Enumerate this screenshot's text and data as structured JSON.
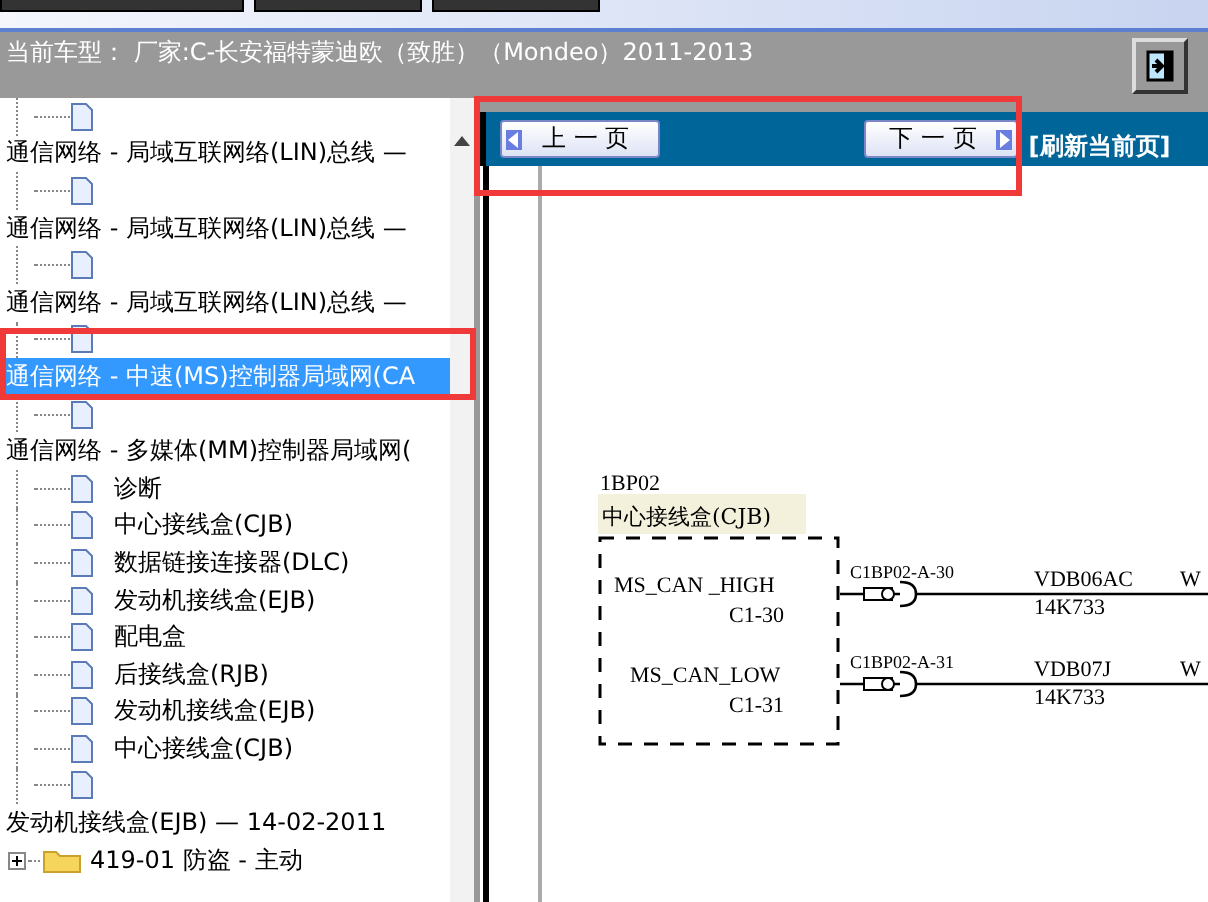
{
  "header": {
    "vehicle_label": "当前车型：  厂家:C-长安福特蒙迪欧（致胜）（Mondeo）2011-2013"
  },
  "tree": [
    {
      "children": [
        {
          "kind": "doc"
        }
      ]
    },
    {
      "kind": "group",
      "label": "通信网络 - 局域互联网络(LIN)总线 —",
      "selected": false,
      "children": [
        {
          "kind": "doc"
        }
      ]
    },
    {
      "kind": "group",
      "label": "通信网络 - 局域互联网络(LIN)总线 —",
      "selected": false,
      "children": [
        {
          "kind": "doc"
        }
      ]
    },
    {
      "kind": "group",
      "label": "通信网络 - 局域互联网络(LIN)总线 —",
      "selected": false,
      "children": [
        {
          "kind": "doc"
        }
      ]
    },
    {
      "kind": "group",
      "label": "通信网络 - 中速(MS)控制器局域网(CA",
      "selected": true,
      "children": [
        {
          "kind": "doc"
        }
      ]
    },
    {
      "kind": "group",
      "label": "通信网络 - 多媒体(MM)控制器局域网(",
      "selected": false,
      "children": [
        {
          "kind": "doc",
          "label": "诊断"
        },
        {
          "kind": "doc",
          "label": "中心接线盒(CJB)"
        },
        {
          "kind": "doc",
          "label": "数据链接连接器(DLC)"
        },
        {
          "kind": "doc",
          "label": "发动机接线盒(EJB)"
        },
        {
          "kind": "doc",
          "label": "配电盒"
        },
        {
          "kind": "doc",
          "label": "后接线盒(RJB)"
        },
        {
          "kind": "doc",
          "label": "发动机接线盒(EJB)"
        },
        {
          "kind": "doc",
          "label": "中心接线盒(CJB)"
        },
        {
          "kind": "doc"
        }
      ]
    },
    {
      "kind": "group",
      "label": "发动机接线盒(EJB) — 14-02-2011",
      "selected": false
    },
    {
      "kind": "folder",
      "label": "419-01 防盗 - 主动",
      "expanded": false
    }
  ],
  "toolbar": {
    "prev_button": "上 一 页",
    "next_button": "下 一 页",
    "refresh_link": "[刷新当前页]"
  },
  "diagram": {
    "component_code": "1BP02",
    "component_name": "中心接线盒(CJB)",
    "pins": [
      {
        "signal": "MS_CAN _HIGH",
        "pin": "C1-30",
        "connector": "C1BP02-A-30",
        "wire": "VDB06AC",
        "harness": "14K733",
        "next": "W"
      },
      {
        "signal": "MS_CAN_LOW",
        "pin": "C1-31",
        "connector": "C1BP02-A-31",
        "wire": "VDB07J",
        "harness": "14K733",
        "next": "W"
      }
    ]
  }
}
